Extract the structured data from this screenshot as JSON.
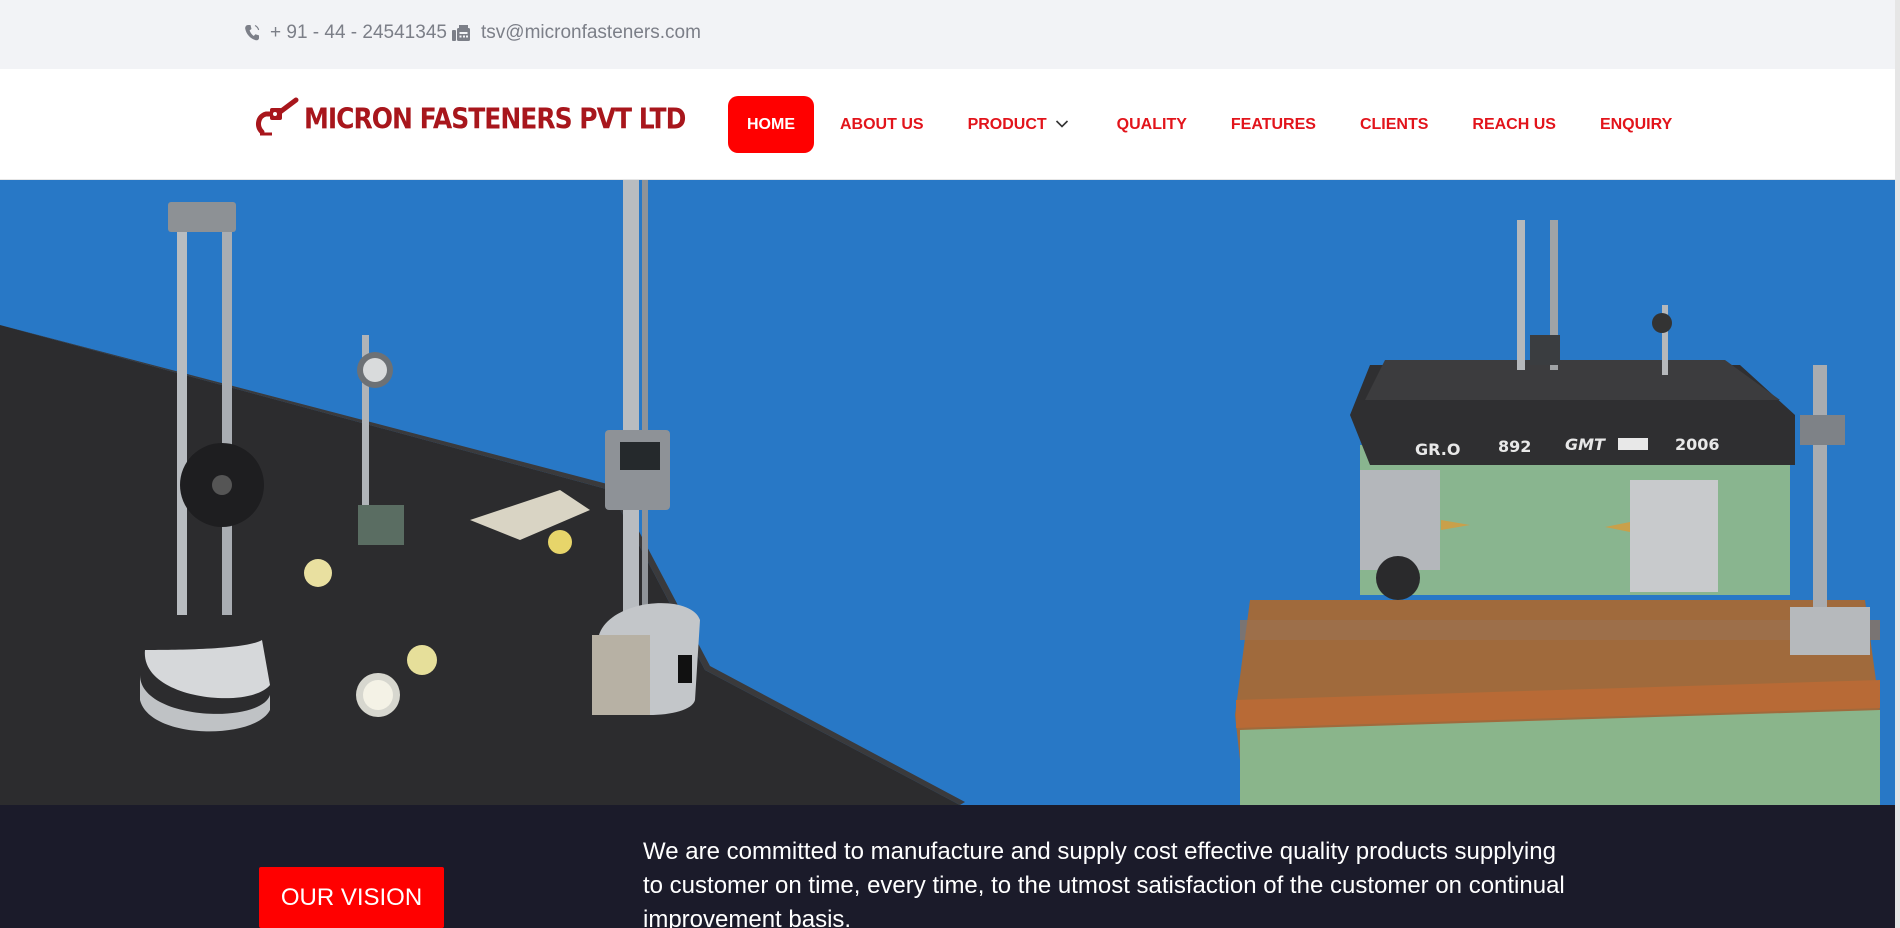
{
  "topbar": {
    "phone": "+ 91 - 44 - 24541345",
    "email": "tsv@micronfasteners.com",
    "phone_icon": "phone-icon",
    "email_icon": "fax-icon"
  },
  "header": {
    "logo_text": "MICRON FASTENERS PVT LTD",
    "nav": [
      {
        "label": "HOME"
      },
      {
        "label": "ABOUT US"
      },
      {
        "label": "PRODUCT"
      },
      {
        "label": "QUALITY"
      },
      {
        "label": "FEATURES"
      },
      {
        "label": "CLIENTS"
      },
      {
        "label": "REACH US"
      },
      {
        "label": "ENQUIRY"
      }
    ]
  },
  "hero": {
    "plate_marking": [
      "GR.O",
      "892",
      "GMT",
      "2006"
    ]
  },
  "vision": {
    "button_label": "OUR VISION",
    "text": "We are committed to manufacture and supply cost effective quality products supplying to customer on time, every time, to the utmost satisfaction of the customer on continual improvement basis."
  },
  "colors": {
    "accent": "#ff0000",
    "nav_text": "#e2141b",
    "hero_bg": "#2878c6",
    "band_bg": "#1b1b2a",
    "topbar_bg": "#f2f3f6"
  }
}
